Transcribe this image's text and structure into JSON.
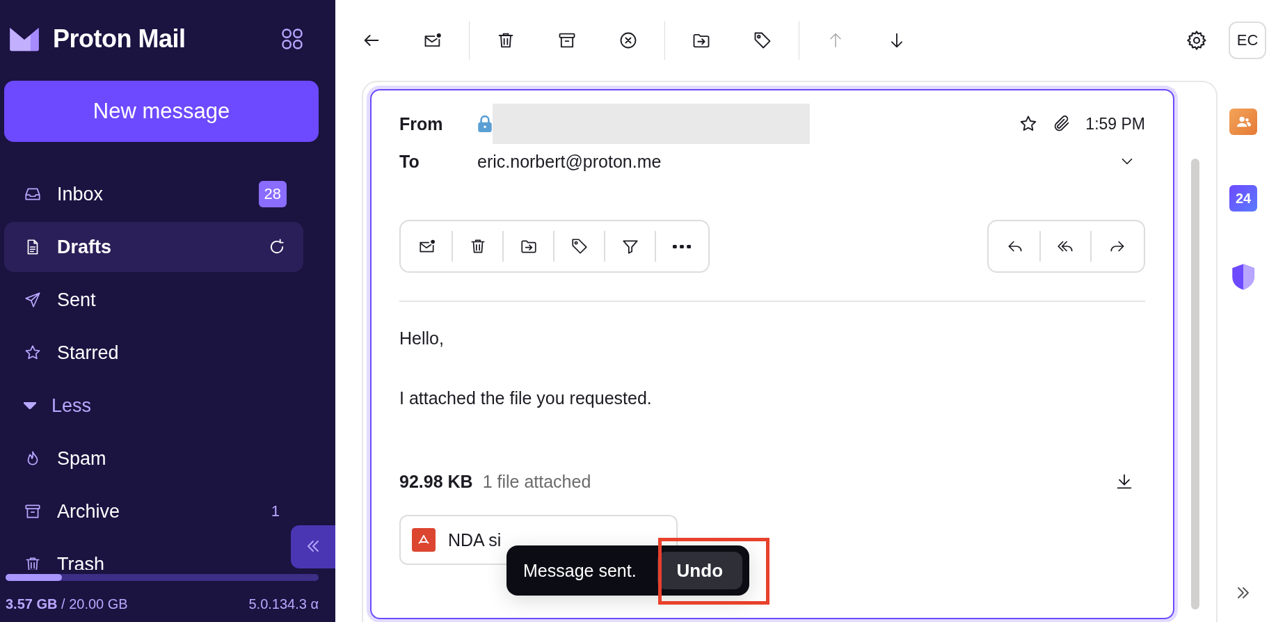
{
  "app": {
    "logo_text": "Proton Mail"
  },
  "sidebar": {
    "compose_button": "New message",
    "folders": [
      {
        "label": "Inbox",
        "selected": false,
        "badge": "28"
      },
      {
        "label": "Drafts",
        "selected": true,
        "refreshing": true
      },
      {
        "label": "Sent",
        "selected": false
      },
      {
        "label": "Starred",
        "selected": false
      },
      {
        "label": "Less",
        "kind": "toggle",
        "expanded": true,
        "selected": false
      },
      {
        "label": "Spam",
        "selected": false
      },
      {
        "label": "Archive",
        "selected": false,
        "count": "1"
      },
      {
        "label": "Trash",
        "selected": false
      }
    ],
    "storage": {
      "usage": "**3.57 GB** / 20.00 GB",
      "level": 0.18
    },
    "version": "5.0.134.3 α"
  },
  "toolbar": [
    {
      "kind": "button",
      "disabled": false
    },
    {
      "kind": "button",
      "disabled": false
    },
    {
      "kind": "separator"
    },
    {
      "kind": "button",
      "disabled": false
    },
    {
      "kind": "button",
      "disabled": false
    },
    {
      "kind": "button",
      "disabled": false
    },
    {
      "kind": "separator"
    },
    {
      "kind": "button",
      "disabled": false
    },
    {
      "kind": "button",
      "disabled": false
    },
    {
      "kind": "separator"
    },
    {
      "kind": "button",
      "disabled": true
    },
    {
      "kind": "button",
      "disabled": false
    }
  ],
  "user": {
    "initials": "EC"
  },
  "message": {
    "from_label": "From",
    "encrypted": true,
    "starred": false,
    "has_attachment": true,
    "time": "1:59 PM",
    "to_label": "To",
    "to": "eric.norbert@proton.me",
    "body": [
      "Hello,",
      "I attached the file you requested."
    ],
    "attachments": {
      "size": "92.98 KB",
      "summary": "1 file attached",
      "files": [
        {
          "name": "NDA si"
        }
      ]
    }
  },
  "toast": {
    "text": "Message sent.",
    "action": "Undo",
    "highlighted": true
  },
  "apps": {
    "calendar_day": "24"
  }
}
